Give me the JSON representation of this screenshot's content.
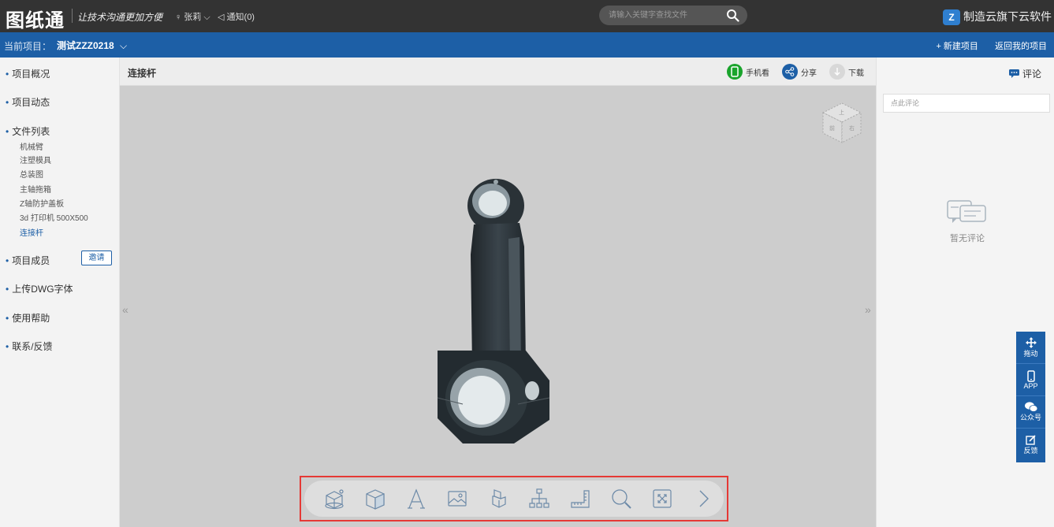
{
  "header": {
    "logo": "图纸通",
    "slogan": "让技术沟通更加方便",
    "user_name": "张莉",
    "notice": "通知(0)",
    "search_placeholder": "请输入关键字查找文件",
    "brand": "制造云旗下云软件"
  },
  "project_bar": {
    "label": "当前项目：",
    "name": "测试ZZZ0218",
    "new_project": "+ 新建项目",
    "back": "返回我的项目"
  },
  "sidebar": {
    "overview": "项目概况",
    "activity": "项目动态",
    "files_title": "文件列表",
    "files": [
      "机械臂",
      "注塑模具",
      "总装图",
      "主轴拖箱",
      "Z轴防护盖板",
      "3d 打印机 500X500",
      "连接杆"
    ],
    "members": "项目成员",
    "invite": "邀请",
    "upload_font": "上传DWG字体",
    "help": "使用帮助",
    "contact": "联系/反馈"
  },
  "viewer": {
    "title": "连接杆",
    "mobile": "手机看",
    "share": "分享",
    "download": "下载",
    "collapse_left": "«",
    "collapse_right": "»"
  },
  "toolbar": {
    "tools": [
      "model-view-icon",
      "box-view-icon",
      "text-icon",
      "image-icon",
      "parts-icon",
      "structure-tree-icon",
      "measure-icon",
      "zoom-icon",
      "fit-icon",
      "next-icon"
    ]
  },
  "comments": {
    "title": "评论",
    "placeholder": "点此评论",
    "empty": "暂无评论"
  },
  "floatbar": {
    "drag": "拖动",
    "app": "APP",
    "wechat": "公众号",
    "feedback": "反馈"
  },
  "colors": {
    "topbar": "#333333",
    "projbar": "#1d5fa6",
    "accent": "#1d5fa6",
    "highlight_box": "#e53935",
    "mobile_btn": "#1aa42c"
  }
}
